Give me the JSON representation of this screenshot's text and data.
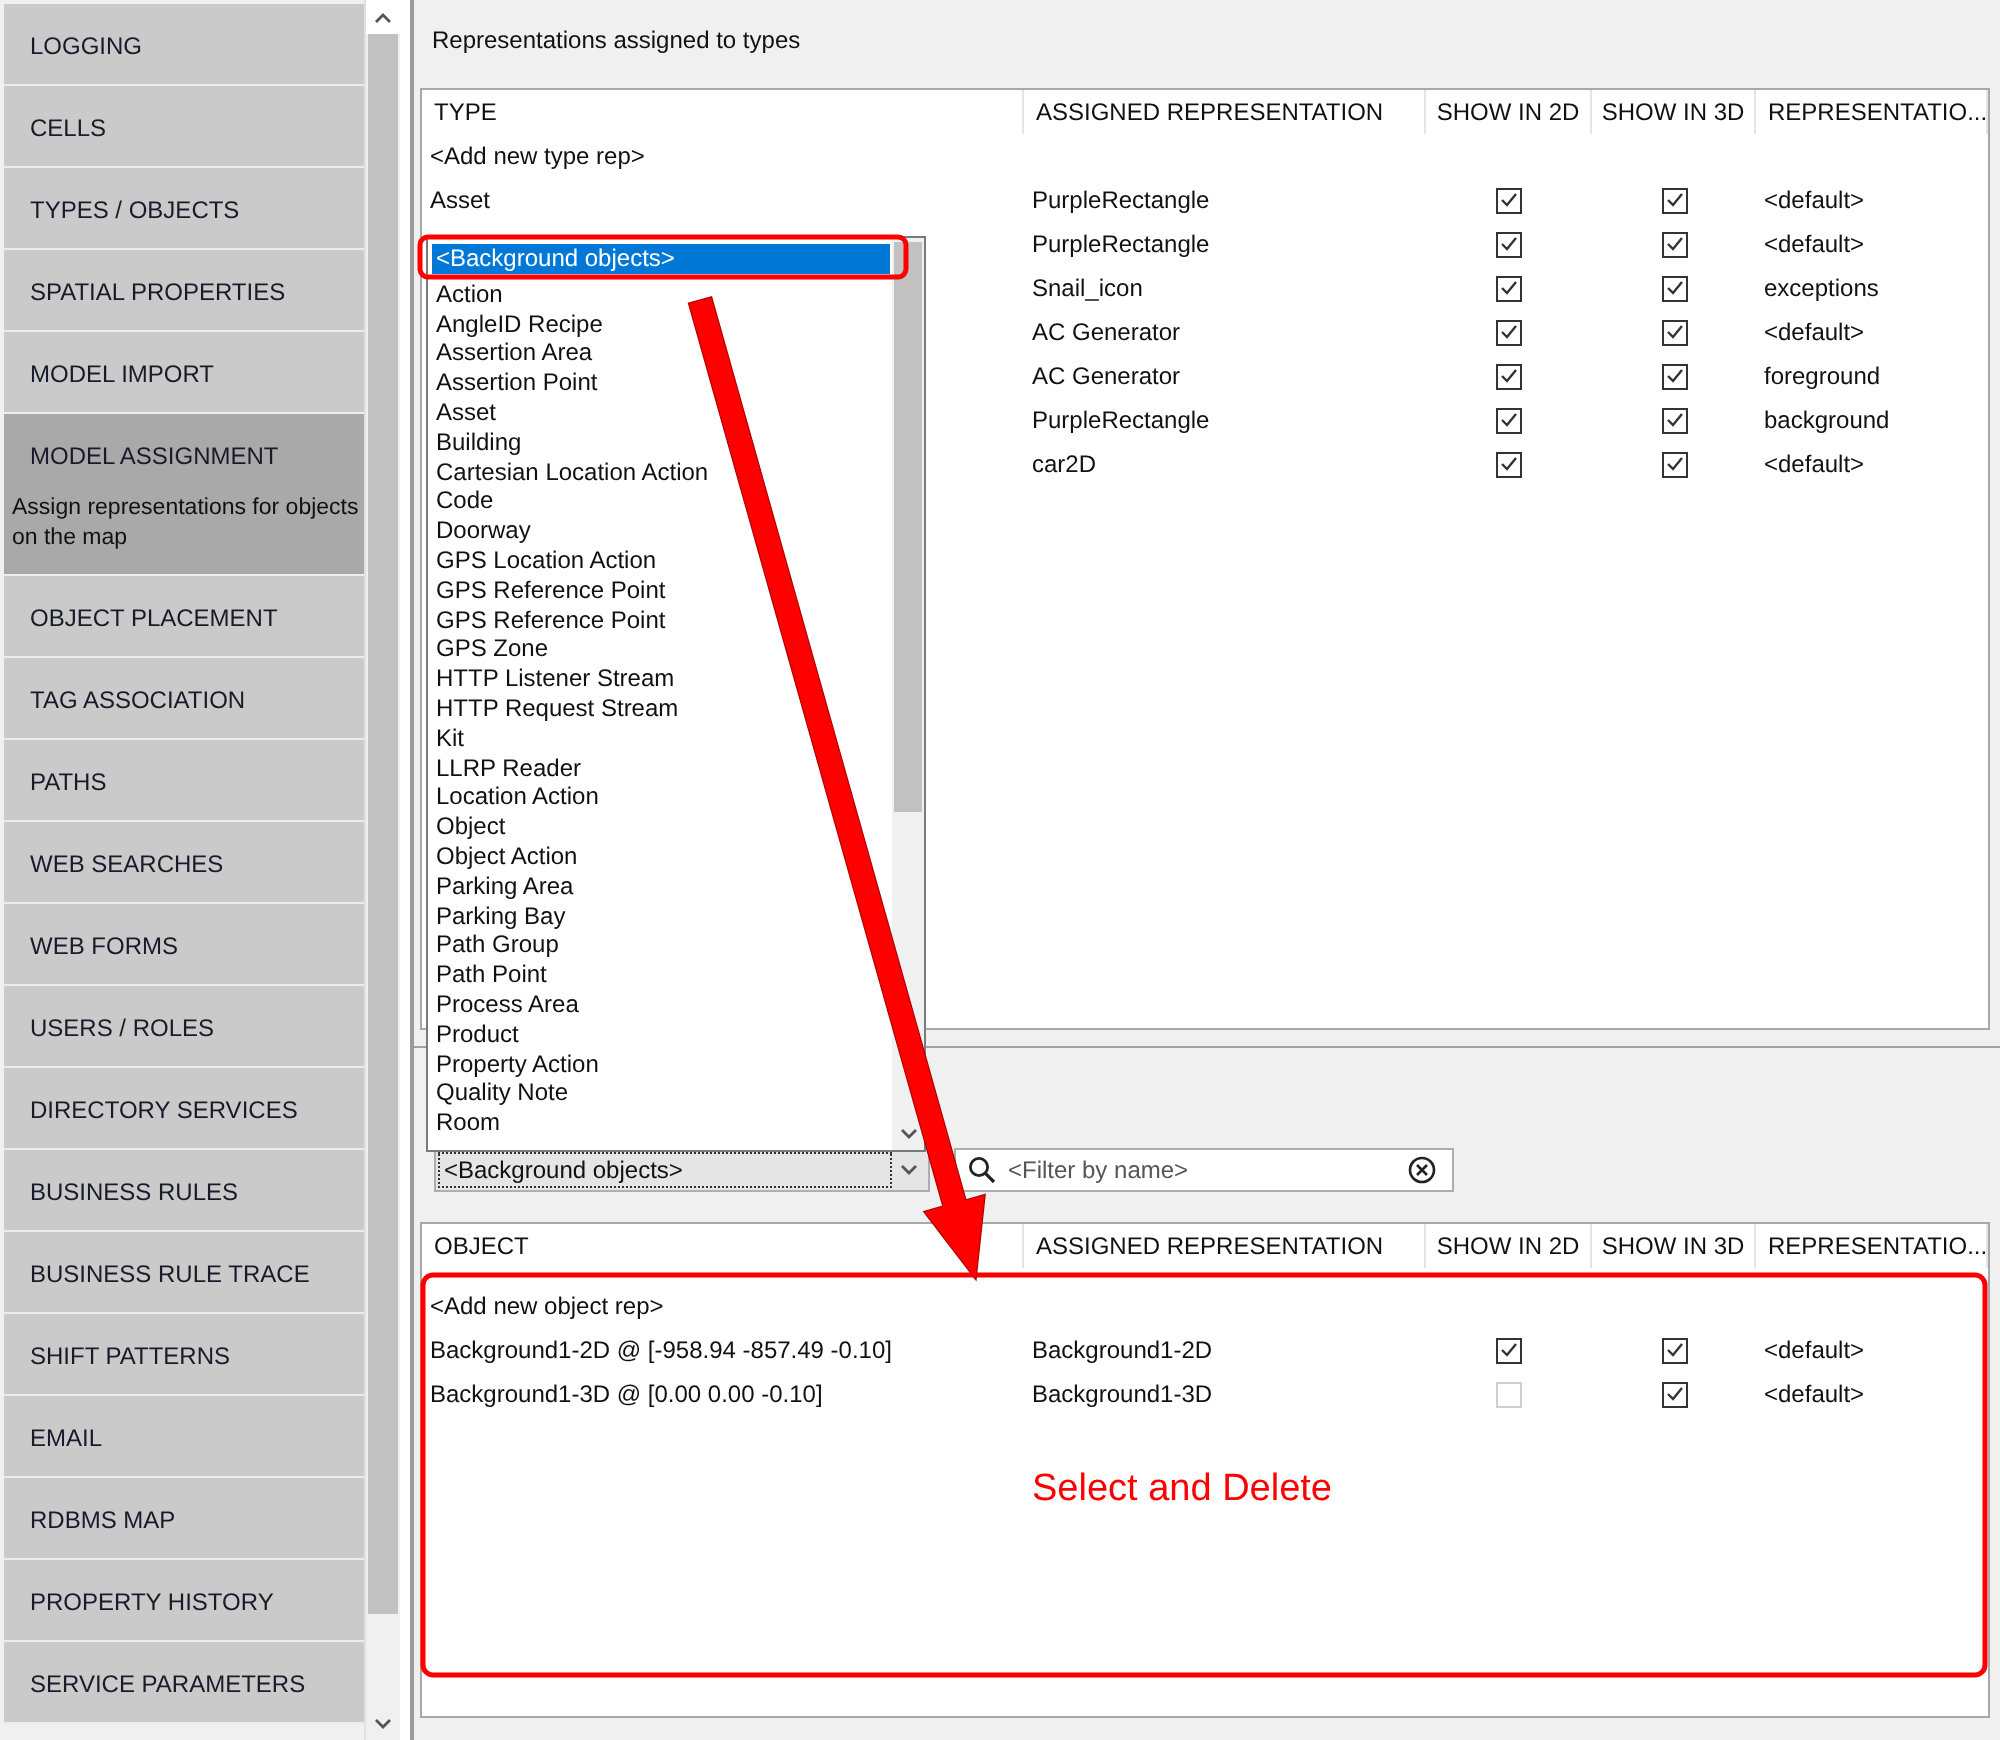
{
  "sidebar": {
    "items": [
      {
        "label": "LOGGING",
        "selected": false
      },
      {
        "label": "CELLS",
        "selected": false
      },
      {
        "label": "TYPES / OBJECTS",
        "selected": false
      },
      {
        "label": "SPATIAL PROPERTIES",
        "selected": false
      },
      {
        "label": "MODEL IMPORT",
        "selected": false
      },
      {
        "label": "MODEL ASSIGNMENT",
        "selected": true,
        "description": "Assign representations for objects on the map"
      },
      {
        "label": "OBJECT PLACEMENT",
        "selected": false
      },
      {
        "label": "TAG ASSOCIATION",
        "selected": false
      },
      {
        "label": "PATHS",
        "selected": false
      },
      {
        "label": "WEB SEARCHES",
        "selected": false
      },
      {
        "label": "WEB FORMS",
        "selected": false
      },
      {
        "label": "USERS / ROLES",
        "selected": false
      },
      {
        "label": "DIRECTORY SERVICES",
        "selected": false
      },
      {
        "label": "BUSINESS RULES",
        "selected": false
      },
      {
        "label": "BUSINESS RULE TRACE",
        "selected": false
      },
      {
        "label": "SHIFT PATTERNS",
        "selected": false
      },
      {
        "label": "EMAIL",
        "selected": false
      },
      {
        "label": "RDBMS MAP",
        "selected": false
      },
      {
        "label": "PROPERTY HISTORY",
        "selected": false
      },
      {
        "label": "SERVICE PARAMETERS",
        "selected": false
      }
    ]
  },
  "types_panel": {
    "title": "Representations assigned to types",
    "columns": [
      "TYPE",
      "ASSIGNED REPRESENTATION",
      "SHOW IN 2D",
      "SHOW IN 3D",
      "REPRESENTATIO..."
    ],
    "add_row": "<Add new type rep>",
    "rows": [
      {
        "type": "Asset",
        "representation": "PurpleRectangle",
        "show_2d": true,
        "show_3d": true,
        "variant": "<default>"
      },
      {
        "representation": "PurpleRectangle",
        "show_2d": true,
        "show_3d": true,
        "variant": "<default>"
      },
      {
        "representation": "Snail_icon",
        "show_2d": true,
        "show_3d": true,
        "variant": "exceptions"
      },
      {
        "representation": "AC Generator",
        "show_2d": true,
        "show_3d": true,
        "variant": "<default>"
      },
      {
        "representation": "AC Generator",
        "show_2d": true,
        "show_3d": true,
        "variant": "foreground"
      },
      {
        "representation": "PurpleRectangle",
        "show_2d": true,
        "show_3d": true,
        "variant": "background"
      },
      {
        "representation": "car2D",
        "show_2d": true,
        "show_3d": true,
        "variant": "<default>"
      }
    ]
  },
  "type_dropdown": {
    "options": [
      {
        "label": "<Background objects>",
        "selected": true
      },
      {
        "label": "Action",
        "selected": false
      },
      {
        "label": "AngleID Recipe",
        "selected": false
      },
      {
        "label": "Assertion Area",
        "selected": false
      },
      {
        "label": "Assertion Point",
        "selected": false
      },
      {
        "label": "Asset",
        "selected": false
      },
      {
        "label": "Building",
        "selected": false
      },
      {
        "label": "Cartesian Location Action",
        "selected": false
      },
      {
        "label": "Code",
        "selected": false
      },
      {
        "label": "Doorway",
        "selected": false
      },
      {
        "label": "GPS Location Action",
        "selected": false
      },
      {
        "label": "GPS Reference Point",
        "selected": false
      },
      {
        "label": "GPS Reference Point",
        "selected": false
      },
      {
        "label": "GPS Zone",
        "selected": false
      },
      {
        "label": "HTTP Listener Stream",
        "selected": false
      },
      {
        "label": "HTTP Request Stream",
        "selected": false
      },
      {
        "label": "Kit",
        "selected": false
      },
      {
        "label": "LLRP Reader",
        "selected": false
      },
      {
        "label": "Location Action",
        "selected": false
      },
      {
        "label": "Object",
        "selected": false
      },
      {
        "label": "Object Action",
        "selected": false
      },
      {
        "label": "Parking Area",
        "selected": false
      },
      {
        "label": "Parking Bay",
        "selected": false
      },
      {
        "label": "Path Group",
        "selected": false
      },
      {
        "label": "Path Point",
        "selected": false
      },
      {
        "label": "Process Area",
        "selected": false
      },
      {
        "label": "Product",
        "selected": false
      },
      {
        "label": "Property Action",
        "selected": false
      },
      {
        "label": "Quality Note",
        "selected": false
      },
      {
        "label": "Room",
        "selected": false
      }
    ]
  },
  "objects_panel": {
    "type_select": {
      "value": "<Background objects>"
    },
    "filter": {
      "placeholder": "<Filter by name>"
    },
    "columns": [
      "OBJECT",
      "ASSIGNED REPRESENTATION",
      "SHOW IN 2D",
      "SHOW IN 3D",
      "REPRESENTATIO..."
    ],
    "add_row": "<Add new object rep>",
    "rows": [
      {
        "object": "Background1-2D @ [-958.94 -857.49 -0.10]",
        "representation": "Background1-2D",
        "show_2d": true,
        "show_3d": true,
        "variant": "<default>"
      },
      {
        "object": "Background1-3D @ [0.00 0.00 -0.10]",
        "representation": "Background1-3D",
        "show_2d": false,
        "show_3d": true,
        "variant": "<default>"
      }
    ]
  },
  "annotation": {
    "callout": "Select and Delete"
  }
}
